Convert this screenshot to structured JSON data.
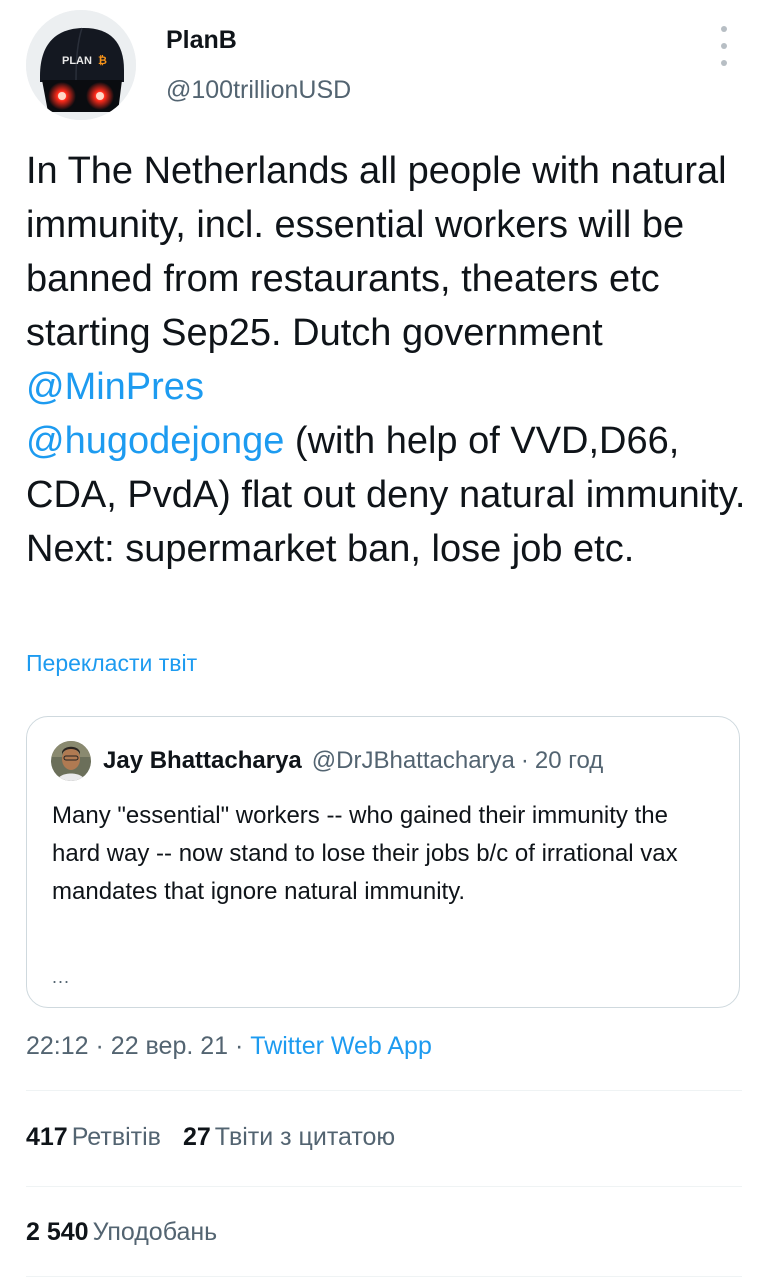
{
  "author": {
    "name": "PlanB",
    "handle": "@100trillionUSD",
    "avatar_cap_text": "PLAN"
  },
  "tweet": {
    "text_part1": "In The Netherlands all people with natural immunity, incl. essential workers will be banned from restaurants, theaters etc starting Sep25. Dutch government ",
    "mention1": "@MinPres",
    "mention2": "@hugodejonge",
    "text_part2": " (with help of VVD,D66, CDA, PvdA) flat out deny natural immunity. Next: supermarket ban, lose job etc.",
    "translate_label": "Перекласти твіт"
  },
  "quote": {
    "name": "Jay Bhattacharya",
    "handle": "@DrJBhattacharya",
    "separator": "·",
    "time": "20 год",
    "text": "Many \"essential\" workers -- who gained their immunity the hard way -- now stand to lose their jobs b/c of irrational vax mandates that ignore natural immunity.",
    "more": "..."
  },
  "meta": {
    "time": "22:12",
    "separator": "·",
    "date": "22 вер. 21",
    "source": "Twitter Web App"
  },
  "stats": {
    "retweets_count": "417",
    "retweets_label": "Ретвітів",
    "quotes_count": "27",
    "quotes_label": "Твіти з цитатою",
    "likes_count": "2 540",
    "likes_label": "Уподобань"
  },
  "colors": {
    "link": "#1d9bf0",
    "secondary_text": "#536471",
    "border": "#cfd9de",
    "avatar_eye_glow": "#ff2a1a"
  }
}
